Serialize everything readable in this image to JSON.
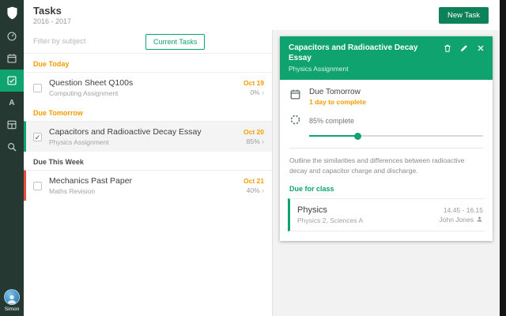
{
  "colors": {
    "accent_green": "#0fa36f",
    "sidebar_bg": "#253832",
    "new_task_button": "#0d8259",
    "due_orange": "#f59b00",
    "subject_red": "#e74c3c",
    "subject_green": "#0fa36f"
  },
  "header": {
    "title": "Tasks",
    "subtitle": "2016 - 2017",
    "new_task_label": "New Task"
  },
  "sidebar": {
    "icons": [
      "shield-logo",
      "dashboard",
      "calendar",
      "tasks",
      "exams",
      "schedule",
      "search"
    ],
    "active_item": "tasks",
    "user_name": "Simon"
  },
  "filter": {
    "placeholder": "Filter by subject",
    "current_tasks_label": "Current Tasks"
  },
  "tasks": {
    "sections": [
      {
        "label": "Due Today",
        "tasks": [
          {
            "title": "Question Sheet Q100s",
            "subtitle": "Computing Assignment",
            "date": "Oct 19",
            "percent": "0%",
            "checked": false,
            "selected": false,
            "subject_color": ""
          }
        ]
      },
      {
        "label": "Due Tomorrow",
        "tasks": [
          {
            "title": "Capacitors and Radioactive Decay Essay",
            "subtitle": "Physics Assignment",
            "date": "Oct 20",
            "percent": "85%",
            "checked": true,
            "selected": true,
            "subject_color": "#0fa36f"
          }
        ]
      },
      {
        "label": "Due This Week",
        "tasks": [
          {
            "title": "Mechanics Past Paper",
            "subtitle": "Maths Revision",
            "date": "Oct 21",
            "percent": "40%",
            "checked": false,
            "selected": false,
            "subject_color": "#e74c3c"
          }
        ]
      }
    ]
  },
  "detail": {
    "title": "Capacitors and Radioactive Decay Essay",
    "subtitle": "Physics Assignment",
    "due_label": "Due Tomorrow",
    "due_note": "1 day to complete",
    "progress_label": "85% complete",
    "description": "Outline the similarities and differences between radioactive decay and capacitor charge and discharge.",
    "due_for_class_label": "Due for class",
    "class": {
      "title": "Physics",
      "subtitle": "Physics 2, Sciences A",
      "time": "14.45 - 16.15",
      "teacher": "John Jones"
    }
  }
}
